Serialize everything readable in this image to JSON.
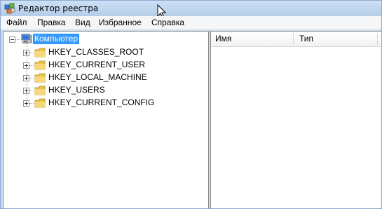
{
  "window": {
    "title": "Редактор реестра"
  },
  "menu": [
    "Файл",
    "Правка",
    "Вид",
    "Избранное",
    "Справка"
  ],
  "tree": {
    "root": {
      "label": "Компьютер",
      "icon": "computer-icon",
      "expanded": true,
      "selected": true
    },
    "children": [
      {
        "label": "HKEY_CLASSES_ROOT",
        "icon": "folder-icon"
      },
      {
        "label": "HKEY_CURRENT_USER",
        "icon": "folder-icon"
      },
      {
        "label": "HKEY_LOCAL_MACHINE",
        "icon": "folder-icon"
      },
      {
        "label": "HKEY_USERS",
        "icon": "folder-icon"
      },
      {
        "label": "HKEY_CURRENT_CONFIG",
        "icon": "folder-icon"
      }
    ]
  },
  "list": {
    "columns": [
      "Имя",
      "Тип"
    ]
  },
  "colors": {
    "selection": "#3399ff",
    "titlebar": "#c8dcf4",
    "folder": "#e8c34e"
  }
}
